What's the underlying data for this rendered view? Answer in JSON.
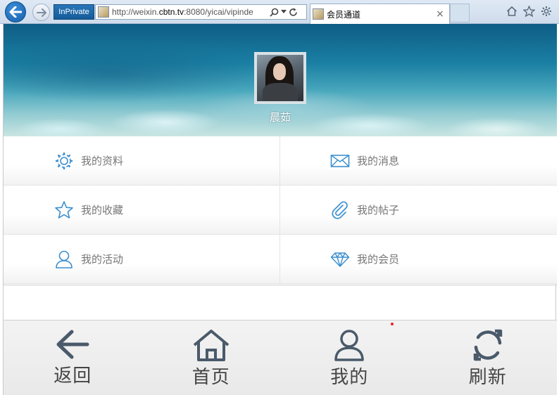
{
  "browser": {
    "mode_badge": "InPrivate",
    "url_prefix": "http://weixin.",
    "url_domain": "cbtn.tv",
    "url_suffix": ":8080/yicai/vipinde",
    "tab_title": "会员通道",
    "tab_close": "×"
  },
  "profile": {
    "username": "晨茹"
  },
  "menu": {
    "rows": [
      [
        {
          "label": "我的资料",
          "icon": "gear-icon"
        },
        {
          "label": "我的消息",
          "icon": "envelope-icon"
        }
      ],
      [
        {
          "label": "我的收藏",
          "icon": "star-icon"
        },
        {
          "label": "我的帖子",
          "icon": "paperclip-icon"
        }
      ],
      [
        {
          "label": "我的活动",
          "icon": "user-icon"
        },
        {
          "label": "我的会员",
          "icon": "diamond-icon"
        }
      ]
    ]
  },
  "bottom_nav": {
    "back": "返回",
    "home": "首页",
    "mine": "我的",
    "refresh": "刷新"
  },
  "colors": {
    "icon_blue": "#3b8fd0",
    "nav_icon": "#4a5a6a",
    "label_gray": "#777777"
  }
}
